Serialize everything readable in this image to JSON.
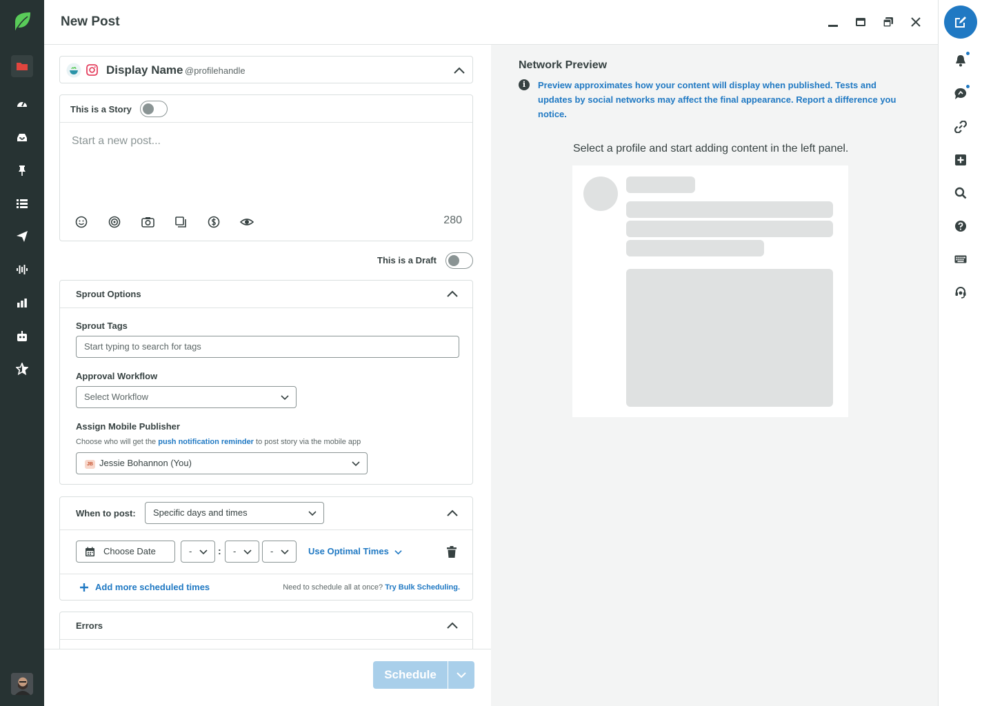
{
  "header": {
    "title": "New Post"
  },
  "profile": {
    "display_name": "Display Name",
    "handle": "@profilehandle"
  },
  "composer": {
    "story_label": "This is a Story",
    "placeholder": "Start a new post...",
    "char_count": "280"
  },
  "draft": {
    "label": "This is a Draft"
  },
  "sprout_options": {
    "title": "Sprout Options",
    "tags_label": "Sprout Tags",
    "tags_placeholder": "Start typing to search for tags",
    "approval_label": "Approval Workflow",
    "approval_value": "Select Workflow",
    "mobile_label": "Assign Mobile Publisher",
    "hint_before": "Choose who will get the ",
    "hint_link": "push notification reminder",
    "hint_after": " to post story via the mobile app",
    "publisher_initials": "JB",
    "publisher_value": "Jessie Bohannon (You)"
  },
  "when": {
    "label": "When to post:",
    "value": "Specific days and times",
    "date_placeholder": "Choose Date",
    "hour": "-",
    "minute": "-",
    "ampm": "-",
    "colon": ":",
    "optimal_label": "Use Optimal Times",
    "add_more": "Add more scheduled times",
    "bulk_prefix": "Need to schedule all at once?",
    "bulk_link": "Try Bulk Scheduling."
  },
  "errors": {
    "title": "Errors"
  },
  "footer": {
    "schedule_label": "Schedule"
  },
  "preview": {
    "title": "Network Preview",
    "note": "Preview approximates how your content will display when published. Tests and updates by social networks may affect the final appearance. Report a difference you notice.",
    "empty_text": "Select a profile and start adding content in the left panel."
  },
  "colors": {
    "brand_green": "#59cb59",
    "accent_blue": "#2079c3",
    "nav_dark": "#273333",
    "instagram": "#e4405f",
    "disabled_button": "#a9cfea"
  },
  "icons": {
    "left_nav": [
      "folder-icon",
      "dashboard-icon",
      "inbox-icon",
      "pin-icon",
      "list-icon",
      "send-icon",
      "listening-icon",
      "reports-icon",
      "bot-icon",
      "star-icon"
    ],
    "right_rail": [
      "compose-icon",
      "bell-icon",
      "messages-icon",
      "link-icon",
      "plus-icon",
      "search-icon",
      "help-icon",
      "keyboard-icon",
      "support-icon"
    ]
  }
}
